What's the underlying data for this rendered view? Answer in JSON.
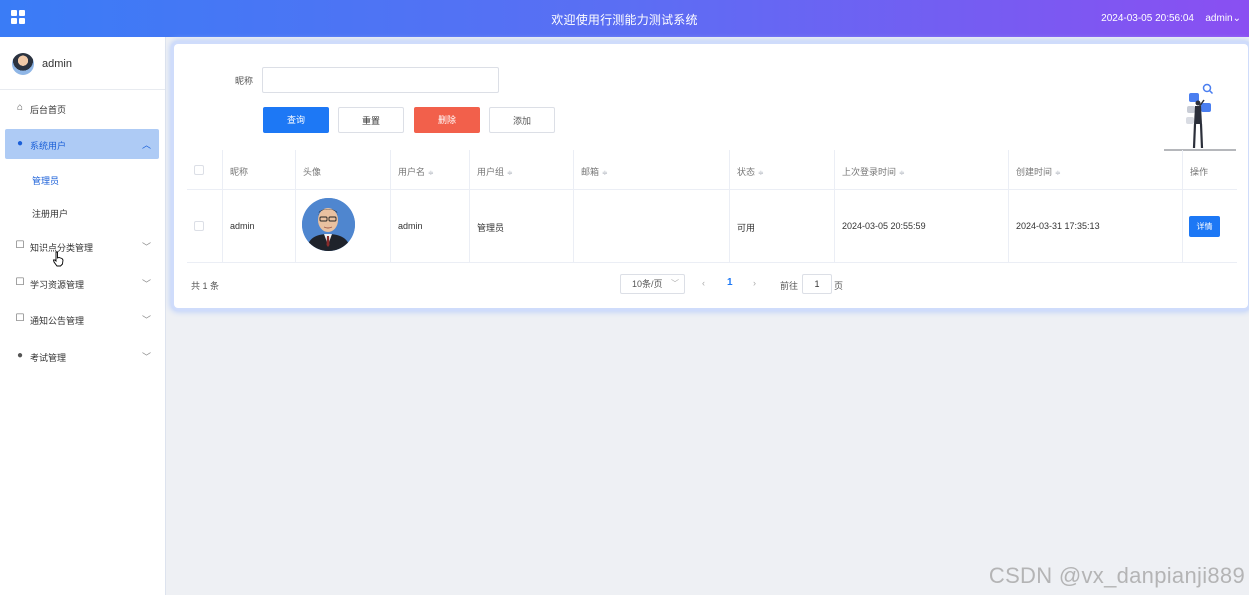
{
  "header": {
    "title": "欢迎使用行测能力测试系统",
    "datetime": "2024-03-05 20:56:04",
    "user": "admin",
    "user_chevron": "⌄"
  },
  "sidebar": {
    "user_name": "admin",
    "items": [
      {
        "label": "后台首页",
        "icon": "home-icon",
        "glyph": "⌂"
      },
      {
        "label": "系统用户",
        "icon": "user-icon",
        "glyph": "●",
        "chevron": "︿",
        "sub": [
          {
            "label": "管理员"
          },
          {
            "label": "注册用户"
          }
        ]
      },
      {
        "label": "知识点分类管理",
        "icon": "note-icon",
        "glyph": "☐",
        "chevron": "﹀"
      },
      {
        "label": "学习资源管理",
        "icon": "note-icon",
        "glyph": "☐",
        "chevron": "﹀"
      },
      {
        "label": "通知公告管理",
        "icon": "note-icon",
        "glyph": "☐",
        "chevron": "﹀"
      },
      {
        "label": "考试管理",
        "icon": "location-icon",
        "glyph": "●",
        "chevron": "﹀"
      }
    ]
  },
  "search": {
    "nickname_label": "昵称",
    "nickname_value": ""
  },
  "buttons": {
    "query": "查询",
    "reset": "重置",
    "delete": "删除",
    "add": "添加"
  },
  "table": {
    "columns": [
      {
        "label": "昵称",
        "sortable": false
      },
      {
        "label": "头像",
        "sortable": false
      },
      {
        "label": "用户名",
        "sortable": true
      },
      {
        "label": "用户组",
        "sortable": true
      },
      {
        "label": "邮箱",
        "sortable": true
      },
      {
        "label": "状态",
        "sortable": true
      },
      {
        "label": "上次登录时间",
        "sortable": true
      },
      {
        "label": "创建时间",
        "sortable": true
      },
      {
        "label": "操作",
        "sortable": false
      }
    ],
    "sort_glyph": "≑",
    "rows": [
      {
        "nickname": "admin",
        "username": "admin",
        "group": "管理员",
        "email": "",
        "status": "可用",
        "last_login": "2024-03-05 20:55:59",
        "created": "2024-03-31 17:35:13",
        "action": "详情"
      }
    ]
  },
  "pagination": {
    "total": "共 1 条",
    "page_size": "10条/页",
    "prev": "‹",
    "current": "1",
    "next": "›",
    "goto_label": "前往",
    "goto_value": "1",
    "goto_unit": "页"
  },
  "watermark": "CSDN @vx_danpianji889",
  "colors": {
    "primary": "#1d78f5",
    "danger": "#f2604b",
    "header_start": "#3a7cf6",
    "header_end": "#8a4ff2"
  }
}
